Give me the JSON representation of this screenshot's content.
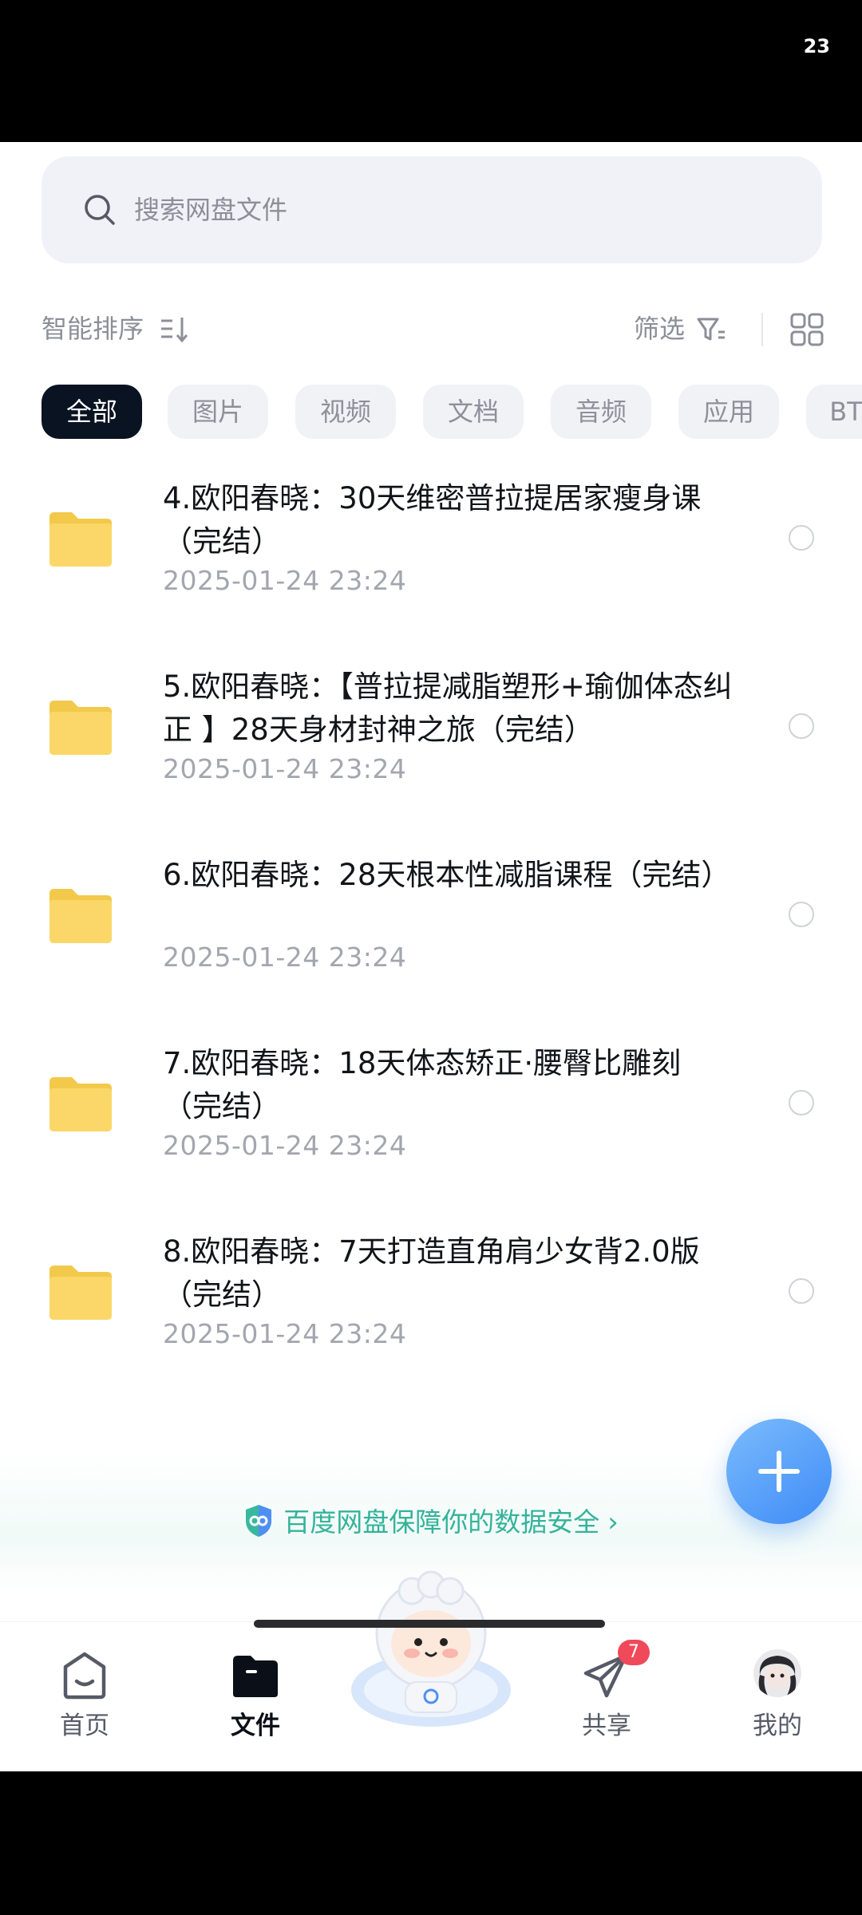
{
  "status_bar": {
    "time": "23"
  },
  "search": {
    "placeholder": "搜索网盘文件"
  },
  "toolbar": {
    "sort_label": "智能排序",
    "filter_label": "筛选"
  },
  "chips": [
    "全部",
    "图片",
    "视频",
    "文档",
    "音频",
    "应用",
    "BT"
  ],
  "files": [
    {
      "name": "4.欧阳春晓：30天维密普拉提居家瘦身课（完结）",
      "date": "2025-01-24  23:24"
    },
    {
      "name": "5.欧阳春晓：【普拉提减脂塑形+瑜伽体态纠正 】28天身材封神之旅（完结）",
      "date": "2025-01-24  23:24"
    },
    {
      "name": "6.欧阳春晓：28天根本性减脂课程（完结）",
      "date": "2025-01-24  23:24"
    },
    {
      "name": "7.欧阳春晓：18天体态矫正·腰臀比雕刻（完结）",
      "date": "2025-01-24  23:24"
    },
    {
      "name": "8.欧阳春晓：7天打造直角肩少女背2.0版（完结）",
      "date": "2025-01-24  23:24"
    }
  ],
  "safety_banner": {
    "text": "百度网盘保障你的数据安全",
    "chevron": "›"
  },
  "tabbar": {
    "home": "首页",
    "files": "文件",
    "share": "共享",
    "share_badge": "7",
    "mine": "我的"
  },
  "colors": {
    "accent": "#3e8bf7",
    "safety": "#34b39a",
    "active_chip": "#0a1321",
    "badge": "#f0495a"
  }
}
